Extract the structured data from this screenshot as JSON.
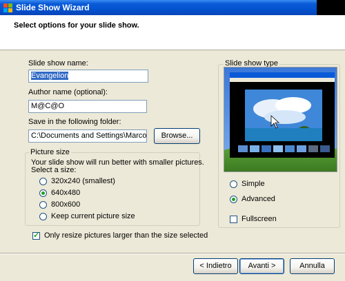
{
  "window": {
    "title": "Slide Show Wizard"
  },
  "header": {
    "subtitle": "Select options for your slide show."
  },
  "form": {
    "name_label": "Slide show name:",
    "name_value": "Evangelion",
    "author_label": "Author name (optional):",
    "author_value": "M@C@O",
    "folder_label": "Save in the following folder:",
    "folder_value": "C:\\Documents and Settings\\Marco\\De",
    "browse_label": "Browse..."
  },
  "picture_size": {
    "legend": "Picture size",
    "hint_line1": "Your slide show will run better with smaller pictures.",
    "hint_line2": "Select a size:",
    "options": [
      {
        "label": "320x240 (smallest)",
        "selected": false
      },
      {
        "label": "640x480",
        "selected": true
      },
      {
        "label": "800x600",
        "selected": false
      },
      {
        "label": "Keep current picture size",
        "selected": false
      }
    ]
  },
  "resize_checkbox": {
    "label": "Only resize pictures larger than the size selected",
    "checked": true
  },
  "slide_show_type": {
    "legend": "Slide show type",
    "options": [
      {
        "label": "Simple",
        "selected": false
      },
      {
        "label": "Advanced",
        "selected": true
      }
    ],
    "fullscreen_label": "Fullscreen",
    "fullscreen_checked": false
  },
  "buttons": {
    "back": "< Indietro",
    "next": "Avanti >",
    "cancel": "Annulla"
  },
  "colors": {
    "title_bar": "#0a5ad8",
    "dialog_bg": "#ece9d8",
    "selection": "#316ac5",
    "radio_dot": "#21a121"
  }
}
